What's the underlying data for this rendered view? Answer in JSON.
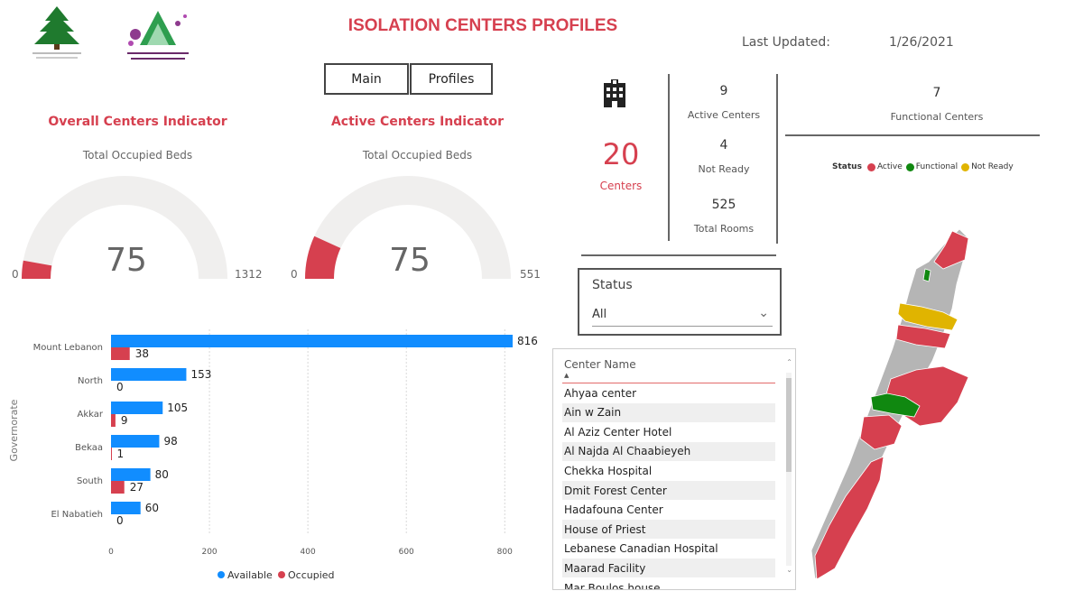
{
  "header": {
    "title": "ISOLATION CENTERS PROFILES",
    "last_updated_label": "Last Updated:",
    "last_updated_value": "1/26/2021"
  },
  "nav": {
    "main_label": "Main",
    "profiles_label": "Profiles"
  },
  "logos": {
    "left": "cedar-logo",
    "right": "committee-logo"
  },
  "gauges": [
    {
      "title": "Overall Centers Indicator",
      "subtitle": "Total Occupied Beds",
      "value": "75",
      "min": "0",
      "max": "1312",
      "fraction": 0.057
    },
    {
      "title": "Active Centers Indicator",
      "subtitle": "Total Occupied Beds",
      "value": "75",
      "min": "0",
      "max": "551",
      "fraction": 0.136
    }
  ],
  "kpis": {
    "centers_icon": "building-icon",
    "centers_value": "20",
    "centers_label": "Centers",
    "active_value": "9",
    "active_label": "Active Centers",
    "notready_value": "4",
    "notready_label": "Not Ready",
    "rooms_value": "525",
    "rooms_label": "Total Rooms",
    "functional_value": "7",
    "functional_label": "Functional Centers"
  },
  "map": {
    "legend_title": "Status",
    "legend": [
      {
        "label": "Active",
        "color": "#d6404f"
      },
      {
        "label": "Functional",
        "color": "#108810"
      },
      {
        "label": "Not Ready",
        "color": "#e0b400"
      }
    ],
    "base_color": "#b5b5b5"
  },
  "slicer": {
    "title": "Status",
    "value": "All"
  },
  "table": {
    "header": "Center Name",
    "rows": [
      "Ahyaa center",
      "Ain w Zain",
      "Al Aziz Center Hotel",
      "Al Najda Al Chaabieyeh",
      "Chekka Hospital",
      "Dmit Forest Center",
      "Hadafouna Center",
      "House of Priest",
      "Lebanese Canadian Hospital",
      "Maarad Facility",
      "Mar Boulos house"
    ]
  },
  "chart_data": {
    "type": "bar",
    "orientation": "horizontal",
    "categories": [
      "Mount Lebanon",
      "North",
      "Akkar",
      "Bekaa",
      "South",
      "El Nabatieh"
    ],
    "series": [
      {
        "name": "Available",
        "color": "#118dff",
        "values": [
          816,
          153,
          105,
          98,
          80,
          60
        ]
      },
      {
        "name": "Occupied",
        "color": "#d6404f",
        "values": [
          38,
          0,
          9,
          1,
          27,
          0
        ]
      }
    ],
    "ylabel": "Governorate",
    "xlim": [
      0,
      816
    ],
    "x_ticks": [
      "0",
      "200",
      "400",
      "600",
      "800"
    ],
    "legend_position": "bottom",
    "grid": true
  }
}
